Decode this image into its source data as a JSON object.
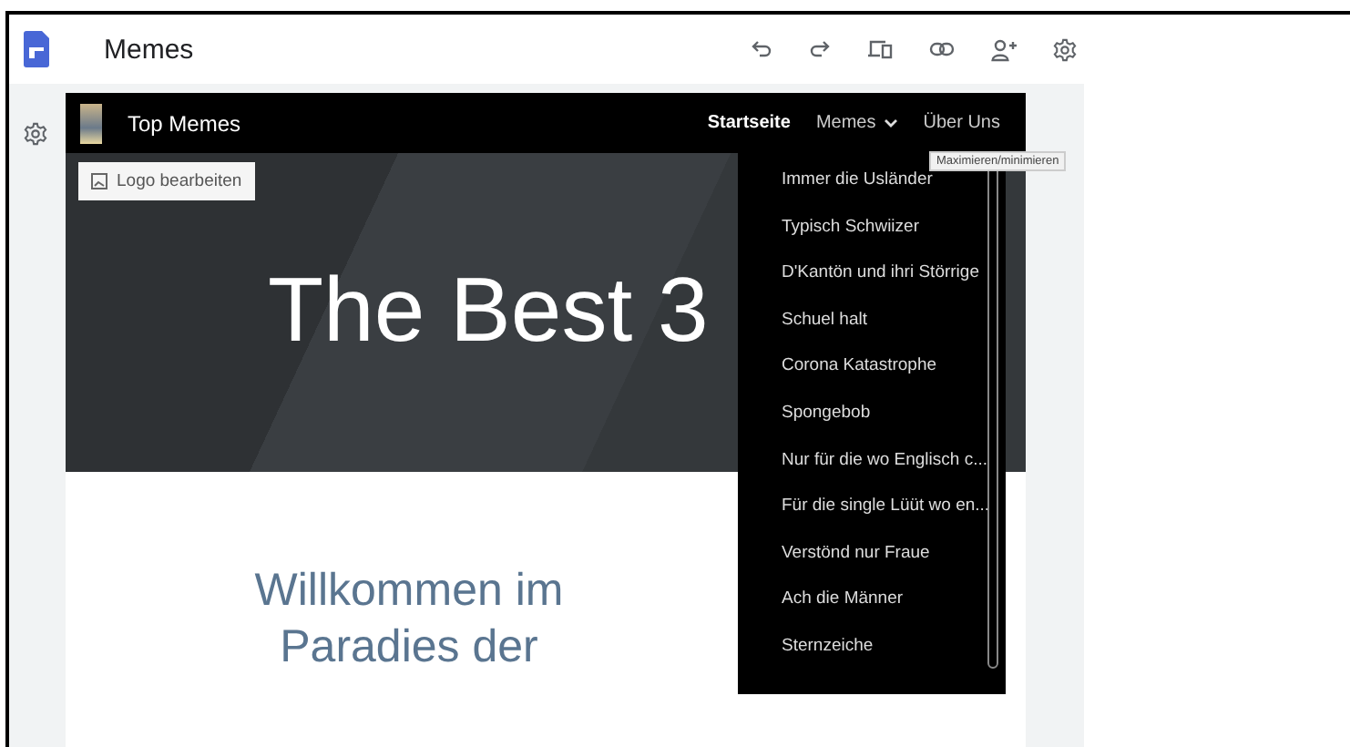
{
  "app": {
    "title": "Memes"
  },
  "site": {
    "title": "Top Memes",
    "logo_button": "Logo bearbeiten",
    "nav": [
      {
        "label": "Startseite",
        "selected": true,
        "kind": "link"
      },
      {
        "label": "Memes",
        "selected": false,
        "kind": "dropdown"
      },
      {
        "label": "Über Uns",
        "selected": false,
        "kind": "link"
      }
    ],
    "hero_title": "The Best 3",
    "welcome": [
      "Willkommen im",
      "Paradies der"
    ]
  },
  "dropdown": {
    "tooltip": "Maximieren/minimieren",
    "items": [
      "Immer die Usländer",
      "Typisch Schwiizer",
      "D'Kantön und ihri Störrige",
      "Schuel halt",
      "Corona Katastrophe",
      "Spongebob",
      "Nur für die wo Englisch c...",
      "Für die single Lüüt wo en...",
      "Verstönd nur Fraue",
      "Ach die Männer",
      "Sternzeiche"
    ]
  }
}
